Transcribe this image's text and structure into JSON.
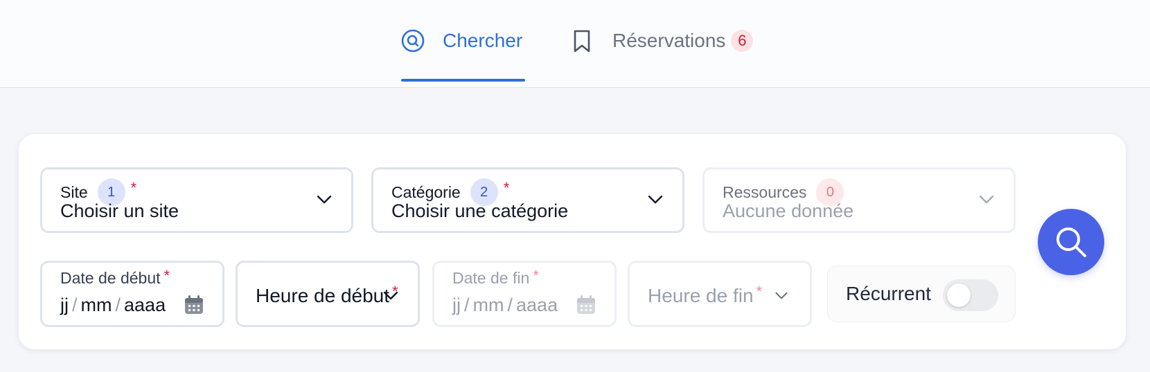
{
  "colors": {
    "accent": "#2f6fd6",
    "search_button": "#4a63e6",
    "badge_red": "#d11a3f",
    "background": "#f4f6fa"
  },
  "tabs": {
    "search": {
      "label": "Chercher",
      "icon": "search-circle-icon",
      "active": true
    },
    "reservations": {
      "label": "Réservations",
      "icon": "bookmark-icon",
      "count": "6"
    }
  },
  "form": {
    "site": {
      "label": "Site",
      "step": "1",
      "required": "*",
      "value": "Choisir un site",
      "icon": "chevron-down-icon"
    },
    "category": {
      "label": "Catégorie",
      "step": "2",
      "required": "*",
      "value": "Choisir une catégorie",
      "icon": "chevron-down-icon"
    },
    "resources": {
      "label": "Ressources",
      "count": "0",
      "value": "Aucune donnée",
      "disabled": true,
      "icon": "chevron-down-icon"
    },
    "start_date": {
      "label": "Date de début",
      "required": "*",
      "day": "jj",
      "sep1": "/",
      "month": "mm",
      "sep2": "/",
      "year": "aaaa",
      "icon": "calendar-icon"
    },
    "start_time": {
      "label": "Heure de début",
      "required": "*",
      "icon": "chevron-down-icon"
    },
    "end_date": {
      "label": "Date de fin",
      "required": "*",
      "day": "jj",
      "sep1": "/",
      "month": "mm",
      "sep2": "/",
      "year": "aaaa",
      "disabled": true,
      "icon": "calendar-icon"
    },
    "end_time": {
      "label": "Heure de fin",
      "required": "*",
      "disabled": true,
      "icon": "chevron-down-icon"
    },
    "recurrent": {
      "label": "Récurrent",
      "checked": false
    },
    "search_button": {
      "icon": "search-icon"
    }
  }
}
